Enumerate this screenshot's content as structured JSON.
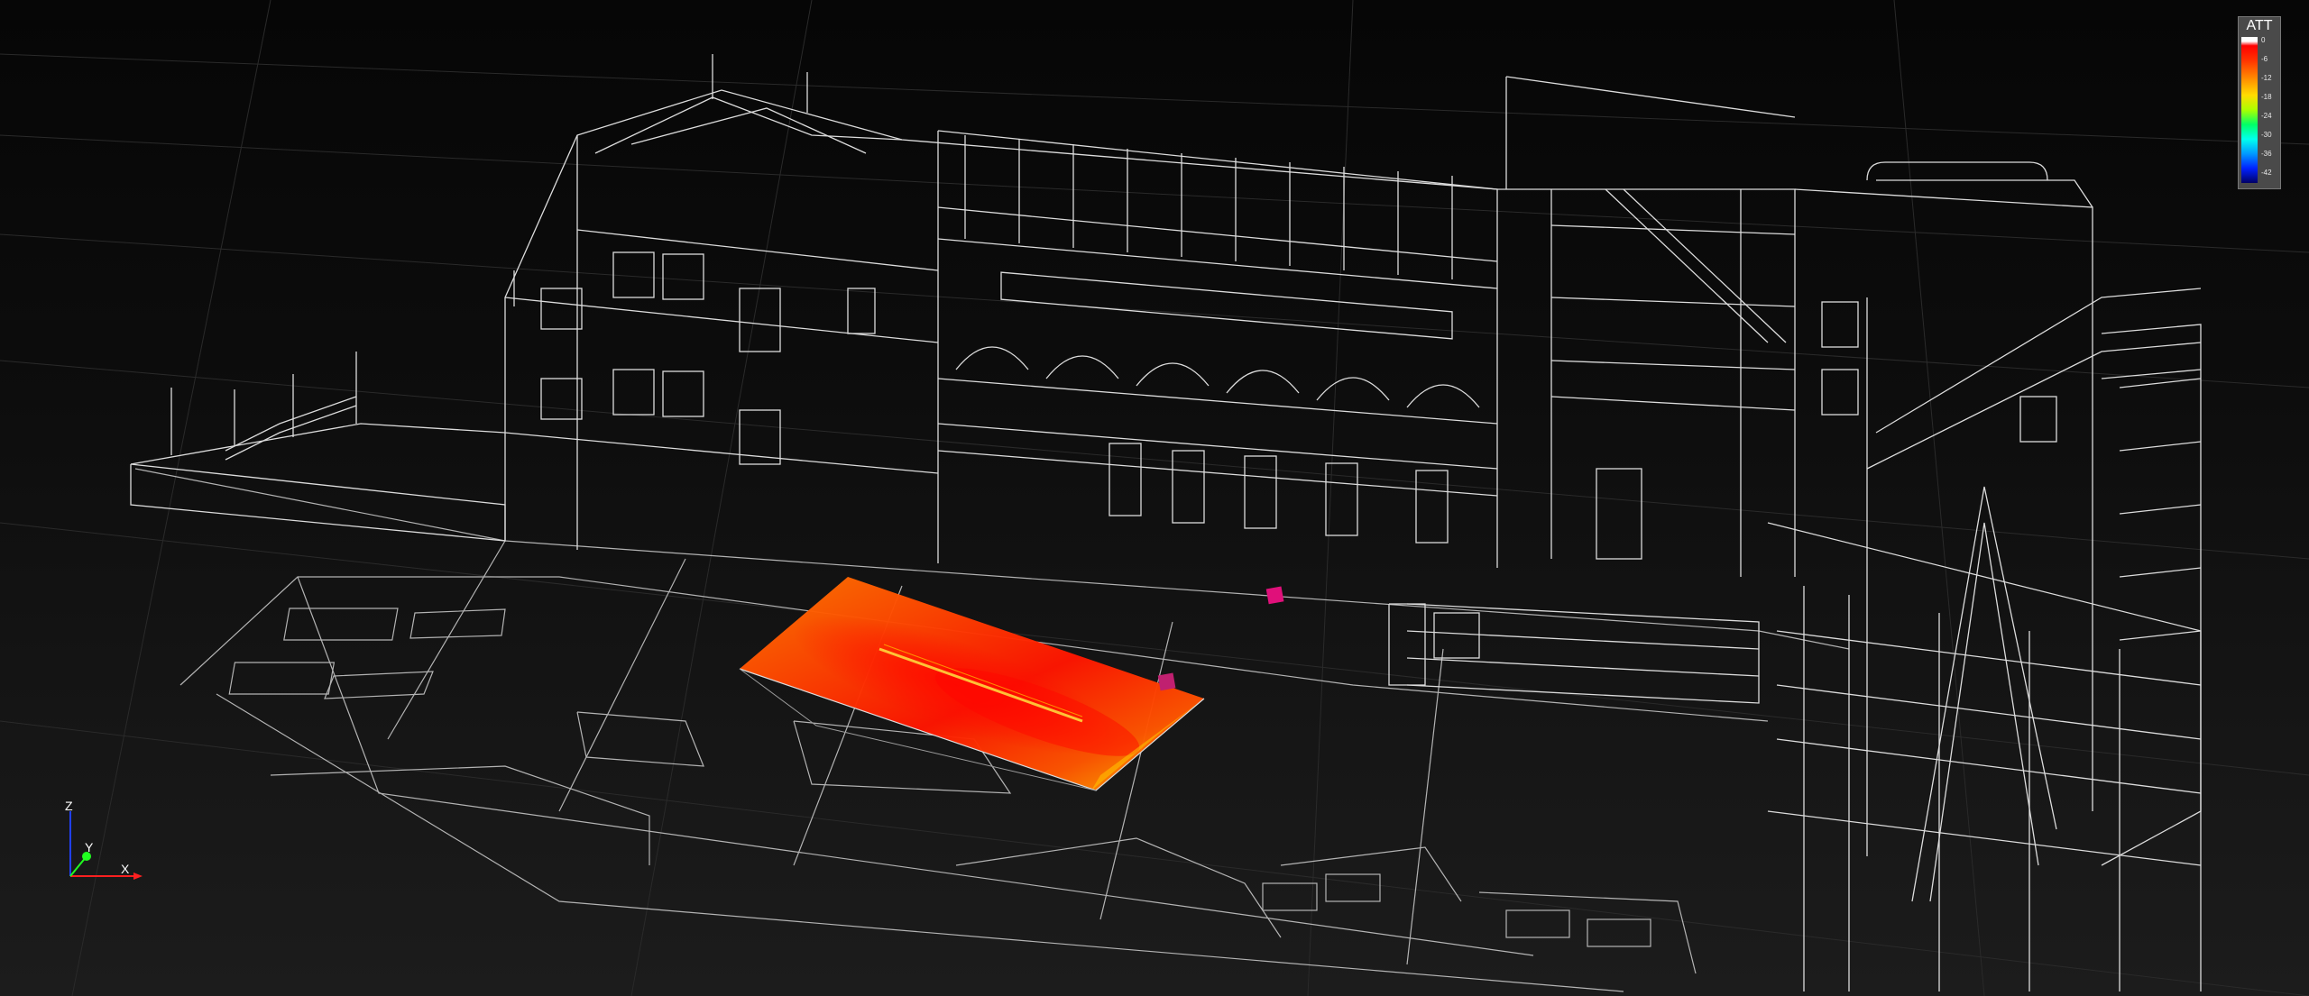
{
  "legend": {
    "title": "ATT",
    "ticks": [
      "0",
      "-6",
      "-12",
      "-18",
      "-24",
      "-30",
      "-36",
      "-42"
    ]
  },
  "axes": {
    "x_label": "X",
    "y_label": "Y",
    "z_label": "Z"
  },
  "colors": {
    "wireframe": "#d8d8d8",
    "heatmap_hot": "#ff2200",
    "heatmap_warm": "#ff8800",
    "heatmap_edge": "#ffcc00",
    "source_marker": "#e0107a",
    "axis_x": "#ff2020",
    "axis_y": "#20ff20",
    "axis_z": "#2040ff"
  }
}
